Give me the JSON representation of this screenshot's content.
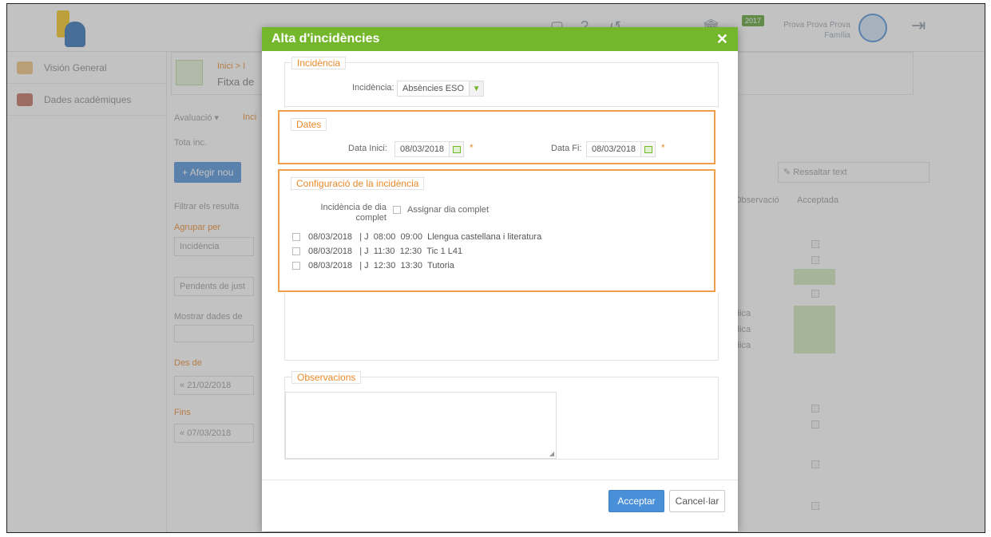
{
  "header": {
    "year_badge": "2017",
    "user_name": "Prova Prova Prova Família"
  },
  "sidebar": {
    "items": [
      {
        "label": "Visión General"
      },
      {
        "label": "Dades acadèmiques"
      }
    ]
  },
  "background": {
    "breadcrumb": "Inici > I",
    "page_title": "Fitxa de",
    "tabs": [
      "Avaluació ▾",
      "Inci"
    ],
    "subtab": "Tota inc.",
    "add_new": "Afegir nou",
    "filter_title": "Filtrar els resulta",
    "group_by": "Agrupar per",
    "group_value": "Incidència",
    "pending": "Pendents de just",
    "show_data": "Mostrar dades de",
    "from_label": "Des de",
    "from_value": "21/02/2018",
    "to_label": "Fins",
    "to_value": "07/03/2018",
    "highlight_text": "Ressaltar text",
    "col_observacio": "Observació",
    "col_acceptada": "Acceptada",
    "cell_text": "dica"
  },
  "modal": {
    "title": "Alta d'incidències",
    "close_icon": "close-icon",
    "incidencia_section": {
      "legend": "Incidència",
      "label": "Incidència:",
      "value": "Absències ESO"
    },
    "dates_section": {
      "legend": "Dates",
      "start_label": "Data Inici:",
      "start_value": "08/03/2018",
      "end_label": "Data Fi:",
      "end_value": "08/03/2018",
      "required_mark": "*"
    },
    "config_section": {
      "legend": "Configuració de la incidència",
      "full_day_label": "Incidència de dia complet",
      "assign_label": "Assignar dia complet",
      "sessions": [
        {
          "date": "08/03/2018",
          "day": "J",
          "start": "08:00",
          "end": "09:00",
          "subject": "Llengua castellana i literatura"
        },
        {
          "date": "08/03/2018",
          "day": "J",
          "start": "11:30",
          "end": "12:30",
          "subject": "Tic 1 L41"
        },
        {
          "date": "08/03/2018",
          "day": "J",
          "start": "12:30",
          "end": "13:30",
          "subject": "Tutoria"
        }
      ]
    },
    "observations_section": {
      "legend": "Observacions",
      "value": ""
    },
    "buttons": {
      "accept": "Acceptar",
      "cancel": "Cancel·lar"
    }
  },
  "colors": {
    "header_green": "#74b72c",
    "accent_orange": "#e9892a",
    "primary_blue": "#4a90d9"
  }
}
